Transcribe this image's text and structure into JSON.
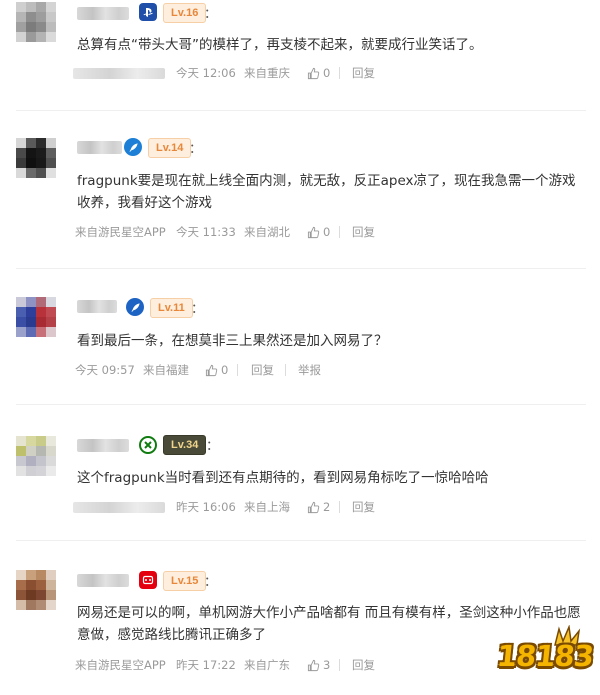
{
  "comments": [
    {
      "level": "Lv.16",
      "platform_icon": "playstation-icon",
      "text": "总算有点“带头大哥”的模样了，再支棱不起来，就要成行业笑话了。",
      "time": "今天 12:06",
      "location": "来自重庆",
      "likes": "0",
      "reply_label": "回复"
    },
    {
      "level": "Lv.14",
      "platform_icon": "feather-badge-icon",
      "text": "fragpunk要是现在就上线全面内测，就无敌，反正apex凉了，现在我急需一个游戏收养，我看好这个游戏",
      "source": "来自游民星空APP",
      "time": "今天 11:33",
      "location": "来自湖北",
      "likes": "0",
      "reply_label": "回复"
    },
    {
      "level": "Lv.11",
      "platform_icon": "feather-badge-icon",
      "text": "看到最后一条，在想莫非三上果然还是加入网易了？",
      "time": "今天 09:57",
      "location": "来自福建",
      "likes": "0",
      "reply_label": "回复",
      "report_label": "举报"
    },
    {
      "level": "Lv.34",
      "platform_icon": "xbox-icon",
      "text": "这个fragpunk当时看到还有点期待的，看到网易角标吃了一惊哈哈哈",
      "time": "昨天 16:06",
      "location": "来自上海",
      "likes": "2",
      "reply_label": "回复"
    },
    {
      "level": "Lv.15",
      "platform_icon": "nintendo-icon",
      "text": "网易还是可以的啊，单机网游大作小产品啥都有 而且有模有样，圣剑这种小作品也愿意做，感觉路线比腾讯正确多了",
      "source": "来自游民星空APP",
      "time": "昨天 17:22",
      "location": "来自广东",
      "likes": "3",
      "reply_label": "回复"
    }
  ],
  "colon": "：",
  "logo_text": "18183",
  "colors": {
    "level_orange": "#e8873a",
    "level_dark_bg": "#4a4a38",
    "meta_gray": "#9a9a9a",
    "playstation_blue": "#1f4fa8",
    "xbox_green": "#107c10",
    "nintendo_red": "#e4000f"
  }
}
